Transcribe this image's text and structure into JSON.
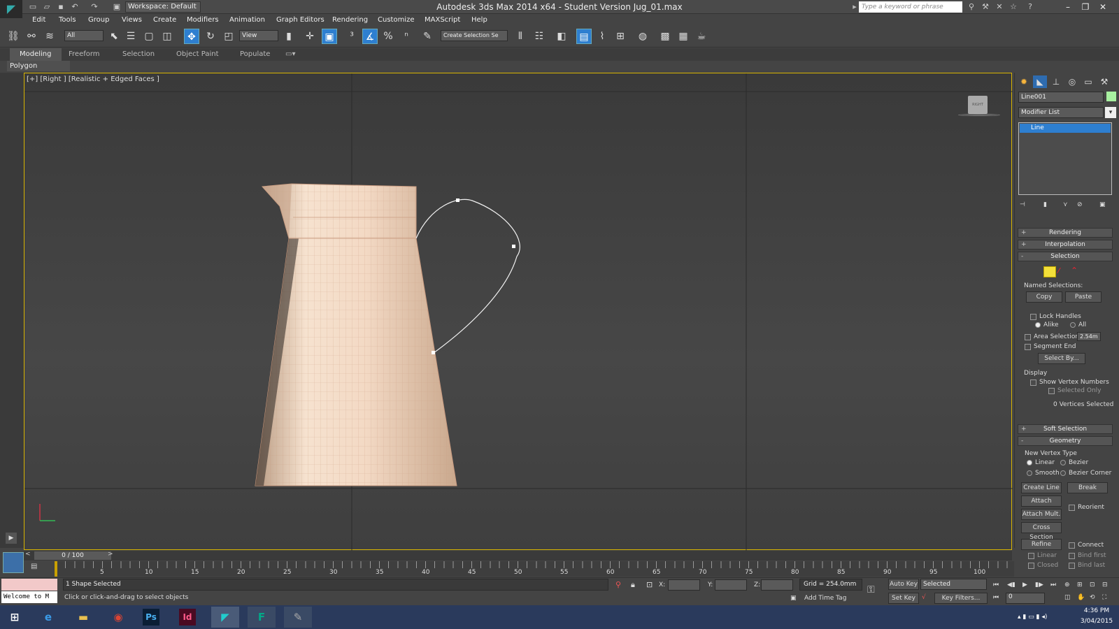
{
  "window": {
    "title": "Autodesk 3ds Max  2014 x64   - Student Version    Jug_01.max",
    "workspace": "Workspace: Default",
    "search_placeholder": "Type a keyword or phrase"
  },
  "menubar": [
    "Edit",
    "Tools",
    "Group",
    "Views",
    "Create",
    "Modifiers",
    "Animation",
    "Graph Editors",
    "Rendering",
    "Customize",
    "MAXScript",
    "Help"
  ],
  "toolbar": {
    "selection_filter": "All",
    "ref_coord": "View",
    "named_selection": "Create Selection Se"
  },
  "ribbon": {
    "tabs": [
      "Modeling",
      "Freeform",
      "Selection",
      "Object Paint",
      "Populate"
    ],
    "active_tab": "Modeling",
    "sub_panel": "Polygon Modeling"
  },
  "viewport": {
    "label": "[+] [Right ] [Realistic + Edged Faces ]",
    "viewcube_label": "RIGHT"
  },
  "command_panel": {
    "object_name": "Line001",
    "modifier_list": "Modifier List",
    "stack_item": "Line",
    "rollouts": {
      "rendering": "Rendering",
      "interpolation": "Interpolation",
      "selection": "Selection",
      "soft_selection": "Soft Selection",
      "geometry": "Geometry"
    },
    "selection": {
      "named_selections": "Named Selections:",
      "copy": "Copy",
      "paste": "Paste",
      "lock_handles": "Lock Handles",
      "alike": "Alike",
      "all": "All",
      "area_selection": "Area Selection:",
      "area_value": "2.54m",
      "segment_end": "Segment End",
      "select_by": "Select By...",
      "display": "Display",
      "show_vertex_numbers": "Show Vertex Numbers",
      "selected_only": "Selected Only",
      "vertices_selected": "0 Vertices Selected"
    },
    "geometry": {
      "new_vertex_type": "New Vertex Type",
      "linear": "Linear",
      "bezier": "Bezier",
      "smooth": "Smooth",
      "bezier_corner": "Bezier Corner",
      "create_line": "Create Line",
      "break": "Break",
      "attach": "Attach",
      "reorient": "Reorient",
      "attach_mult": "Attach Mult.",
      "cross_section": "Cross Section",
      "refine": "Refine",
      "connect": "Connect",
      "linear2": "Linear",
      "bind_first": "Bind first",
      "closed": "Closed",
      "bind_last": "Bind last"
    }
  },
  "timeline": {
    "slider": "0 / 100",
    "ticks": [
      "5",
      "10",
      "15",
      "20",
      "25",
      "30",
      "35",
      "40",
      "45",
      "50",
      "55",
      "60",
      "65",
      "70",
      "75",
      "80",
      "85",
      "90",
      "95",
      "100"
    ]
  },
  "status": {
    "maxscript": "Welcome to M",
    "selected": "1 Shape Selected",
    "prompt": "Click or click-and-drag to select objects",
    "x_label": "X:",
    "y_label": "Y:",
    "z_label": "Z:",
    "grid": "Grid = 254.0mm",
    "add_time_tag": "Add Time Tag",
    "auto_key": "Auto Key",
    "set_key": "Set Key",
    "key_mode": "Selected",
    "key_filters": "Key Filters...",
    "frame": "0"
  },
  "taskbar": {
    "time": "4:36 PM",
    "date": "3/04/2015"
  },
  "colors": {
    "accent": "#2e7fd0",
    "viewport_border": "#d8b400",
    "jug": "#e8c6a8"
  }
}
